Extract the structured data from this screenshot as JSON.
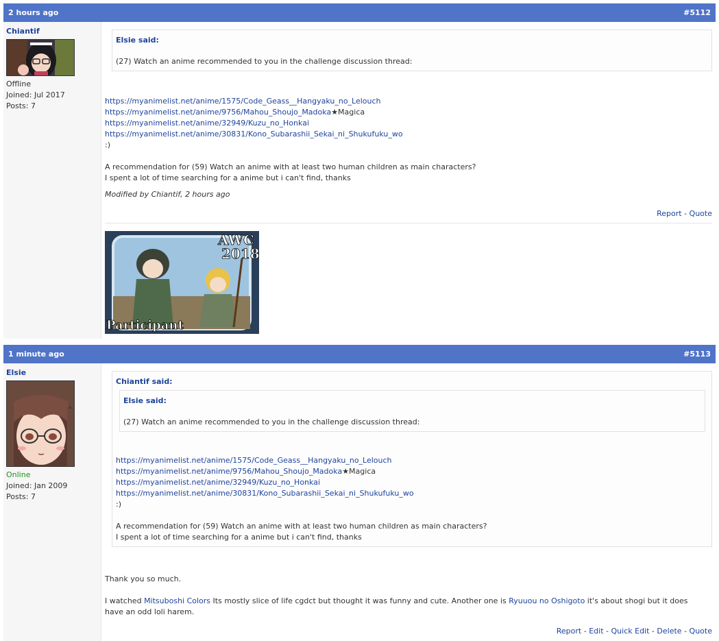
{
  "posts": [
    {
      "time": "2 hours ago",
      "number": "#5112",
      "user": {
        "name": "Chiantif",
        "status": "Offline",
        "joined": "Joined: Jul 2017",
        "posts": "Posts: 7"
      },
      "quote": {
        "author": "Elsie said:",
        "text": "(27) Watch an anime recommended to you in the challenge discussion thread:"
      },
      "links": [
        "https://myanimelist.net/anime/1575/Code_Geass__Hangyaku_no_Lelouch",
        "https://myanimelist.net/anime/9756/Mahou_Shoujo_Madoka",
        "https://myanimelist.net/anime/32949/Kuzu_no_Honkai",
        "https://myanimelist.net/anime/30831/Kono_Subarashii_Sekai_ni_Shukufuku_wo"
      ],
      "link2_suffix": "★Magica",
      "smile": ":)",
      "para1": "A recommendation for (59) Watch an anime with at least two human children as main characters?",
      "para2": "I spent a lot of time searching for a anime but i can't find, thanks",
      "modified": "Modified by Chiantif, 2 hours ago",
      "actions": {
        "report": "Report",
        "quote": "Quote"
      },
      "signature": {
        "top": "AWC",
        "year": "2018",
        "bottom": "Participant"
      }
    },
    {
      "time": "1 minute ago",
      "number": "#5113",
      "user": {
        "name": "Elsie",
        "status": "Online",
        "joined": "Joined: Jan 2009",
        "posts": "Posts: 7"
      },
      "outer_quote": {
        "author": "Chiantif said:"
      },
      "inner_quote": {
        "author": "Elsie said:",
        "text": "(27) Watch an anime recommended to you in the challenge discussion thread:"
      },
      "links": [
        "https://myanimelist.net/anime/1575/Code_Geass__Hangyaku_no_Lelouch",
        "https://myanimelist.net/anime/9756/Mahou_Shoujo_Madoka",
        "https://myanimelist.net/anime/32949/Kuzu_no_Honkai",
        "https://myanimelist.net/anime/30831/Kono_Subarashii_Sekai_ni_Shukufuku_wo"
      ],
      "link2_suffix": "★Magica",
      "smile": ":)",
      "para1": "A recommendation for (59) Watch an anime with at least two human children as main characters?",
      "para2": "I spent a lot of time searching for a anime but i can't find, thanks",
      "thanks": "Thank you so much.",
      "reply": {
        "p1": "I watched ",
        "link1": "Mitsuboshi Colors",
        "p2": " Its mostly slice of life cgdct but thought it was funny and cute. Another one is ",
        "link2": "Ryuuou no Oshigoto",
        "p3": " it's about shogi but it does",
        "p4": "have an odd loli harem."
      },
      "actions": {
        "report": "Report",
        "edit": "Edit",
        "quick_edit": "Quick Edit",
        "delete": "Delete",
        "quote": "Quote"
      }
    }
  ],
  "sep": "-",
  "colors": {
    "header": "#4f74c8",
    "link": "#1d439b",
    "online": "#1e8f1e"
  }
}
